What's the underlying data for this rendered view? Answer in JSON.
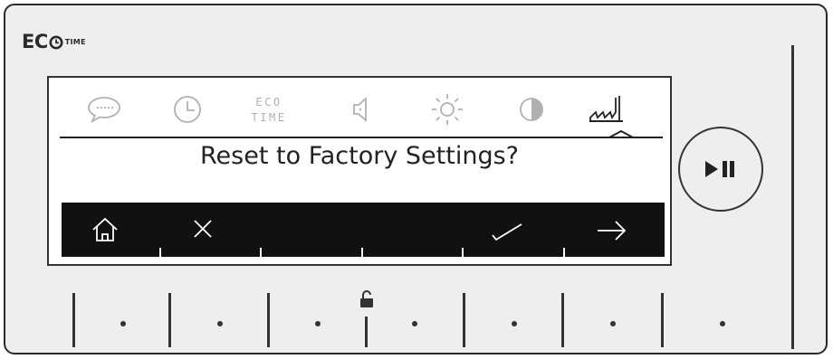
{
  "brand": {
    "eco": "EC",
    "time": "TIME",
    "logo_icon": "clock-o-icon"
  },
  "screen": {
    "menu_icons": [
      {
        "name": "speech-bubble-icon"
      },
      {
        "name": "clock-icon"
      },
      {
        "name": "eco-time-icon",
        "line1": "ECO",
        "line2": "TIME"
      },
      {
        "name": "speaker-icon"
      },
      {
        "name": "brightness-icon"
      },
      {
        "name": "contrast-icon"
      },
      {
        "name": "factory-icon",
        "selected": true
      }
    ],
    "prompt": "Reset to Factory Settings?",
    "softkeys": [
      {
        "name": "home-icon"
      },
      {
        "name": "close-icon"
      },
      {
        "name": "empty"
      },
      {
        "name": "empty"
      },
      {
        "name": "check-icon"
      },
      {
        "name": "arrow-right-icon"
      }
    ]
  },
  "controls": {
    "play_pause_icon": "play-pause-icon",
    "lock_icon": "lock-icon"
  },
  "colors": {
    "body": "#eeeeee",
    "ink": "#2a2a2a",
    "softbar": "#111111",
    "screen": "#ffffff",
    "inactive_icon": "#b0b0b0"
  }
}
